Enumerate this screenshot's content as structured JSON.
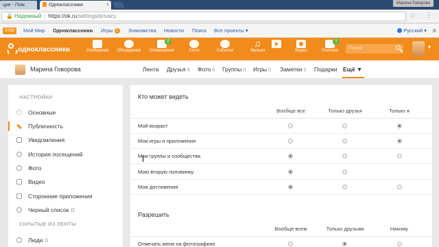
{
  "browser": {
    "tabs": [
      {
        "label": "цие - Пом",
        "active": false
      },
      {
        "label": "Одноклассники",
        "active": true
      }
    ],
    "profile_label": "Марина Говорова",
    "address": {
      "secure_label": "Надежный",
      "host": "https://ok.ru",
      "path": "/settings/privacy"
    }
  },
  "ok_topnav": {
    "mail_badge": "9782",
    "items": [
      "Мой Мир",
      "Одноклассники",
      "Игры",
      "Знакомства",
      "Новости",
      "Поиск",
      "Все проекты ▾"
    ],
    "games_count": "1",
    "language": "Русский ▾"
  },
  "header": {
    "logo_text": "одноклассники",
    "nav": [
      {
        "label": "Сообщения",
        "icon": "envelope-icon",
        "badge": ""
      },
      {
        "label": "Обсуждения",
        "icon": "chat-bubbles-icon",
        "badge": ""
      },
      {
        "label": "Оповещения",
        "icon": "bell-icon",
        "badge": "2"
      },
      {
        "label": "Гости",
        "icon": "footprints-icon",
        "badge": ""
      },
      {
        "label": "События",
        "icon": "events-icon",
        "badge": ""
      },
      {
        "label": "Музыка",
        "icon": "music-note-icon",
        "badge": ""
      },
      {
        "label": "",
        "icon": "play-icon",
        "badge": ""
      },
      {
        "label": "Видео",
        "icon": "camera-icon",
        "badge": ""
      },
      {
        "label": "Платежи",
        "icon": "wallet-icon",
        "badge": "1"
      }
    ],
    "search_placeholder": "Поиск"
  },
  "profile": {
    "name": "Марина Говорова",
    "nav": [
      {
        "label": "Лента",
        "count": ""
      },
      {
        "label": "Друзья",
        "count": "9"
      },
      {
        "label": "Фото",
        "count": "6"
      },
      {
        "label": "Группы",
        "count": "0"
      },
      {
        "label": "Игры",
        "count": "0"
      },
      {
        "label": "Заметки",
        "count": "0"
      },
      {
        "label": "Подарки",
        "count": ""
      },
      {
        "label": "Ещё ▼",
        "count": ""
      }
    ]
  },
  "sidebar": {
    "section_settings": "НАСТРОЙКИ",
    "items": [
      {
        "label": "Основные",
        "count": ""
      },
      {
        "label": "Публичность",
        "count": ""
      },
      {
        "label": "Уведомления",
        "count": ""
      },
      {
        "label": "История посещений",
        "count": ""
      },
      {
        "label": "Фото",
        "count": ""
      },
      {
        "label": "Видео",
        "count": ""
      },
      {
        "label": "Сторонние приложения",
        "count": ""
      },
      {
        "label": "Черный список",
        "count": "0"
      }
    ],
    "section_hidden": "СКРЫТЫЕ ИЗ ЛЕНТЫ",
    "hidden_items": [
      {
        "label": "Люди",
        "count": "0"
      }
    ]
  },
  "privacy": {
    "who_can_see": {
      "title": "Кто может видеть",
      "columns": [
        "Вообще все",
        "Только друзья",
        "Только я"
      ],
      "rows": [
        {
          "label": "Мой возраст",
          "selected": 2
        },
        {
          "label": "Мои игры и приложения",
          "selected": 2
        },
        {
          "label": "Мои группы и сообщества",
          "selected": 0
        },
        {
          "label": "Мою вторую половинку",
          "selected": 0
        },
        {
          "label": "Мои достижения",
          "selected": 0
        }
      ]
    },
    "allow": {
      "title": "Разрешить",
      "columns": [
        "Вообще всем",
        "Только друзьям",
        "Никому"
      ],
      "rows": [
        {
          "label": "Отмечать меня на фотографиях",
          "selected": 1
        }
      ]
    }
  }
}
